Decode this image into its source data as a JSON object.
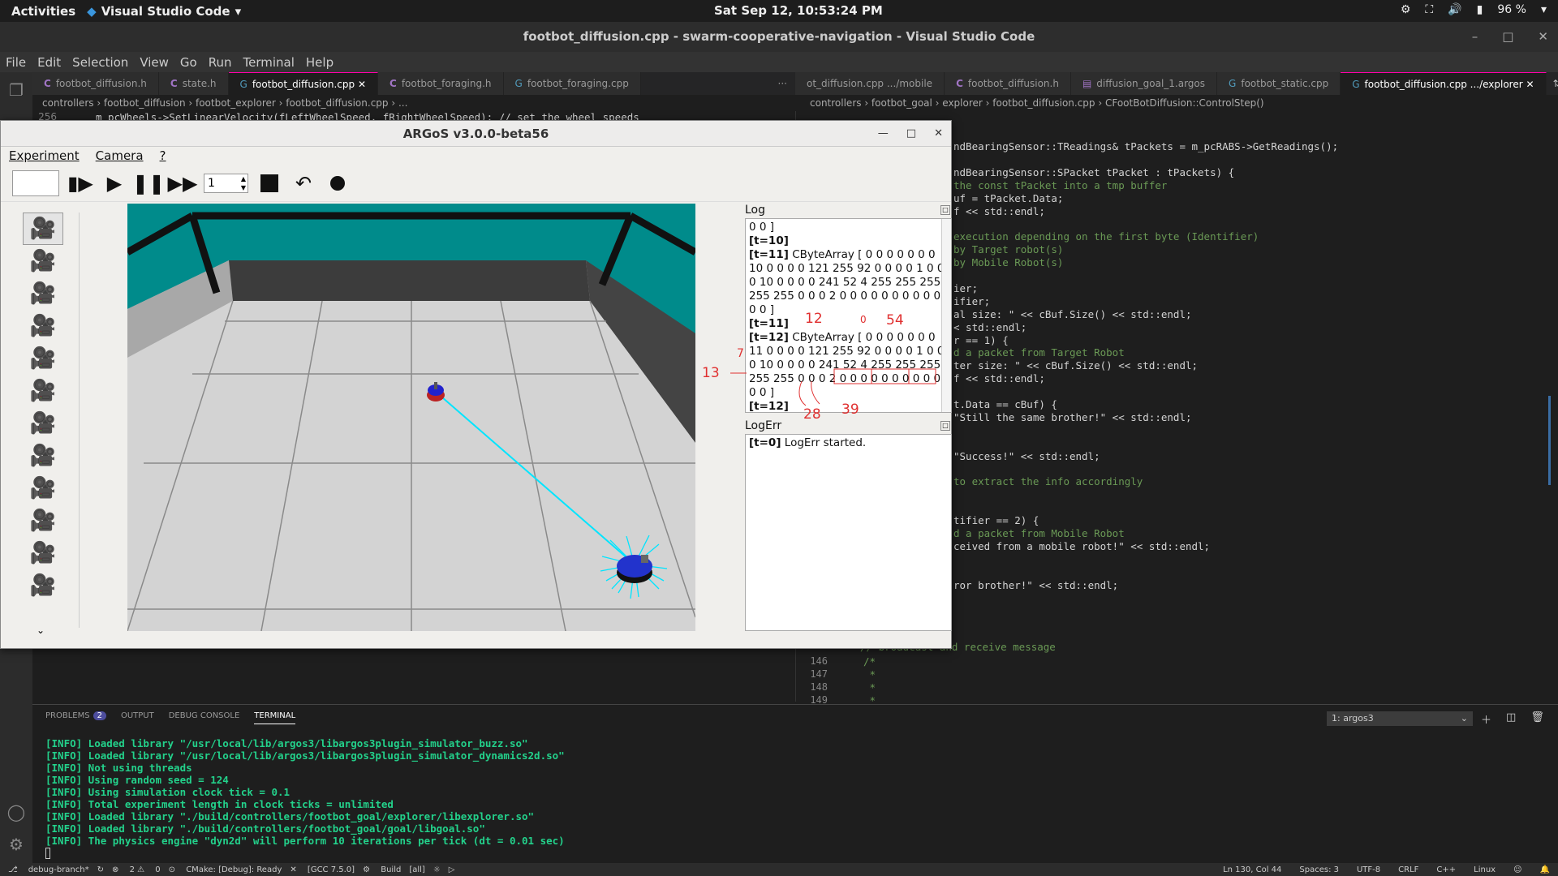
{
  "topbar": {
    "activities": "Activities",
    "app": "Visual Studio Code",
    "clock": "Sat Sep 12, 10:53:24 PM",
    "battery": "96 %"
  },
  "vscode": {
    "title": "footbot_diffusion.cpp - swarm-cooperative-navigation - Visual Studio Code",
    "menu": [
      "File",
      "Edit",
      "Selection",
      "View",
      "Go",
      "Run",
      "Terminal",
      "Help"
    ],
    "left_tabs": [
      "footbot_diffusion.h",
      "state.h",
      "footbot_diffusion.cpp",
      "footbot_foraging.h",
      "footbot_foraging.cpp"
    ],
    "right_tabs": [
      "ot_diffusion.cpp .../mobile",
      "footbot_diffusion.h",
      "diffusion_goal_1.argos",
      "footbot_static.cpp",
      "footbot_diffusion.cpp .../explorer"
    ],
    "left_crumbs": "controllers › footbot_diffusion › footbot_explorer › footbot_diffusion.cpp › ...",
    "right_crumbs": "controllers › footbot_goal › explorer › footbot_diffusion.cpp › CFootBotDiffusion::ControlStep()",
    "left_code_line": "m_pcWheels->SetLinearVelocity(fLeftWheelSpeed, fRightWheelSpeed); // set the wheel speeds",
    "left_code_lnum": "256",
    "right_code": [
      "ndBearingSensor::TReadings& tPackets = m_pcRABS->GetReadings();",
      "",
      "ndBearingSensor::SPacket tPacket : tPackets) {",
      "the const tPacket into a tmp buffer",
      "uf = tPacket.Data;",
      "f << std::endl;",
      "",
      "execution depending on the first byte (Identifier)",
      "by Target robot(s)",
      "by Mobile Robot(s)",
      "",
      "ier;",
      "ifier;",
      "al size: \" << cBuf.Size() << std::endl;",
      "< std::endl;",
      "r == 1) {",
      "d a packet from Target Robot",
      "ter size: \" << cBuf.Size() << std::endl;",
      "f << std::endl;",
      "",
      "t.Data == cBuf) {",
      "\"Still the same brother!\" << std::endl;",
      "",
      "",
      "\"Success!\" << std::endl;",
      "",
      "to extract the info accordingly",
      "",
      "",
      "tifier == 2) {",
      "d a packet from Mobile Robot",
      "ceived from a mobile robot!\" << std::endl;",
      "",
      "",
      "ror brother!\" << std::endl;"
    ],
    "right_lower_lnums": [
      "146",
      "147",
      "148",
      "149"
    ],
    "right_lower_code": [
      "/*",
      " *",
      " *",
      " *"
    ],
    "right_lower_comment": "// broadcast and receive message"
  },
  "panel": {
    "tabs": [
      "PROBLEMS",
      "OUTPUT",
      "DEBUG CONSOLE",
      "TERMINAL"
    ],
    "problems_count": "2",
    "terminal_select": "1: argos3",
    "terminal_lines": [
      "[INFO] Loaded library \"/usr/local/lib/argos3/libargos3plugin_simulator_buzz.so\"",
      "[INFO] Loaded library \"/usr/local/lib/argos3/libargos3plugin_simulator_dynamics2d.so\"",
      "[INFO] Not using threads",
      "[INFO] Using random seed = 124",
      "[INFO] Using simulation clock tick = 0.1",
      "[INFO] Total experiment length in clock ticks = unlimited",
      "[INFO] Loaded library \"./build/controllers/footbot_goal/explorer/libexplorer.so\"",
      "[INFO] Loaded library \"./build/controllers/footbot_goal/goal/libgoal.so\"",
      "[INFO] The physics engine \"dyn2d\" will perform 10 iterations per tick (dt = 0.01 sec)"
    ]
  },
  "status": {
    "branch": "debug-branch*",
    "errors": "2",
    "warnings": "0",
    "cmake": "CMake: [Debug]: Ready",
    "kit": "[GCC 7.5.0]",
    "build": "Build",
    "target": "[all]",
    "position": "Ln 130, Col 44",
    "spaces": "Spaces: 3",
    "encoding": "UTF-8",
    "eol": "CRLF",
    "lang": "C++",
    "os": "Linux"
  },
  "argos": {
    "title": "ARGoS v3.0.0-beta56",
    "menu": [
      "Experiment",
      "Camera",
      "?"
    ],
    "speed_value": "1",
    "log_title": "Log",
    "log_lines": [
      {
        "tag": "",
        "text": "0 0 ]"
      },
      {
        "tag": "[t=10]",
        "text": ""
      },
      {
        "tag": "[t=11]",
        "text": " CByteArray [ 0 0 0 0 0 0 0"
      },
      {
        "tag": "",
        "text": "10 0 0 0 0 121 255 92 0 0 0 0 1 0 0"
      },
      {
        "tag": "",
        "text": "0 10 0 0 0 0 241 52 4 255 255 255"
      },
      {
        "tag": "",
        "text": "255 255 0 0 0 2 0 0 0 0 0 0 0 0 0 0"
      },
      {
        "tag": "",
        "text": "0 0 ]"
      },
      {
        "tag": "[t=11]",
        "text": ""
      },
      {
        "tag": "[t=12]",
        "text": " CByteArray [ 0 0 0 0 0 0 0"
      },
      {
        "tag": "",
        "text": "11 0 0 0 0 121 255 92 0 0 0 0 1 0 0"
      },
      {
        "tag": "",
        "text": "0 10 0 0 0 0 241 52 4 255 255 255"
      },
      {
        "tag": "",
        "text": "255 255 0 0 0 2 0 0 0 0 0 0 0 0 0 0"
      },
      {
        "tag": "",
        "text": "0 0 ]"
      },
      {
        "tag": "[t=12]",
        "text": ""
      }
    ],
    "annotations": [
      "12",
      "0",
      "54",
      "13",
      "7",
      "28",
      "39"
    ],
    "logerr_title": "LogErr",
    "logerr_tag": "[t=0]",
    "logerr_text": " LogErr started."
  }
}
